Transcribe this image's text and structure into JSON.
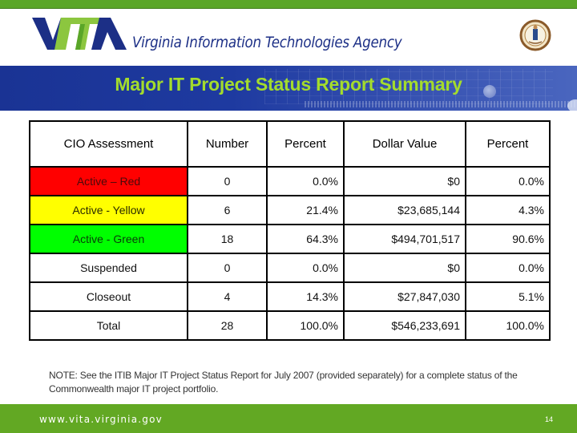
{
  "header": {
    "logo_text": "VITA",
    "agency_name": "Virginia Information Technologies Agency",
    "seal": "virginia-state-seal"
  },
  "slide": {
    "title": "Major IT Project Status Report Summary"
  },
  "table": {
    "columns": [
      "CIO Assessment",
      "Number",
      "Percent",
      "Dollar Value",
      "Percent"
    ],
    "rows": [
      {
        "assessment": "Active – Red",
        "number": "0",
        "percent": "0.0%",
        "dollar_value": "$0",
        "dollar_percent": "0.0%",
        "color": "#ff0000"
      },
      {
        "assessment": "Active - Yellow",
        "number": "6",
        "percent": "21.4%",
        "dollar_value": "$23,685,144",
        "dollar_percent": "4.3%",
        "color": "#ffff00"
      },
      {
        "assessment": "Active - Green",
        "number": "18",
        "percent": "64.3%",
        "dollar_value": "$494,701,517",
        "dollar_percent": "90.6%",
        "color": "#00ff00"
      },
      {
        "assessment": "Suspended",
        "number": "0",
        "percent": "0.0%",
        "dollar_value": "$0",
        "dollar_percent": "0.0%",
        "color": "#ffffff"
      },
      {
        "assessment": "Closeout",
        "number": "4",
        "percent": "14.3%",
        "dollar_value": "$27,847,030",
        "dollar_percent": "5.1%",
        "color": "#ffffff"
      },
      {
        "assessment": "Total",
        "number": "28",
        "percent": "100.0%",
        "dollar_value": "$546,233,691",
        "dollar_percent": "100.0%",
        "color": "#ffffff"
      }
    ]
  },
  "note": "NOTE: See the ITIB Major IT Project Status Report for July 2007 (provided separately) for a complete status of the Commonwealth major IT project portfolio.",
  "footer": {
    "url": "www.vita.virginia.gov",
    "page_number": "14"
  },
  "colors": {
    "brand_green": "#62a823",
    "brand_blue": "#1c2f86",
    "title_green": "#a4dc2c",
    "status_red": "#ff0000",
    "status_yellow": "#ffff00",
    "status_green": "#00ff00"
  }
}
